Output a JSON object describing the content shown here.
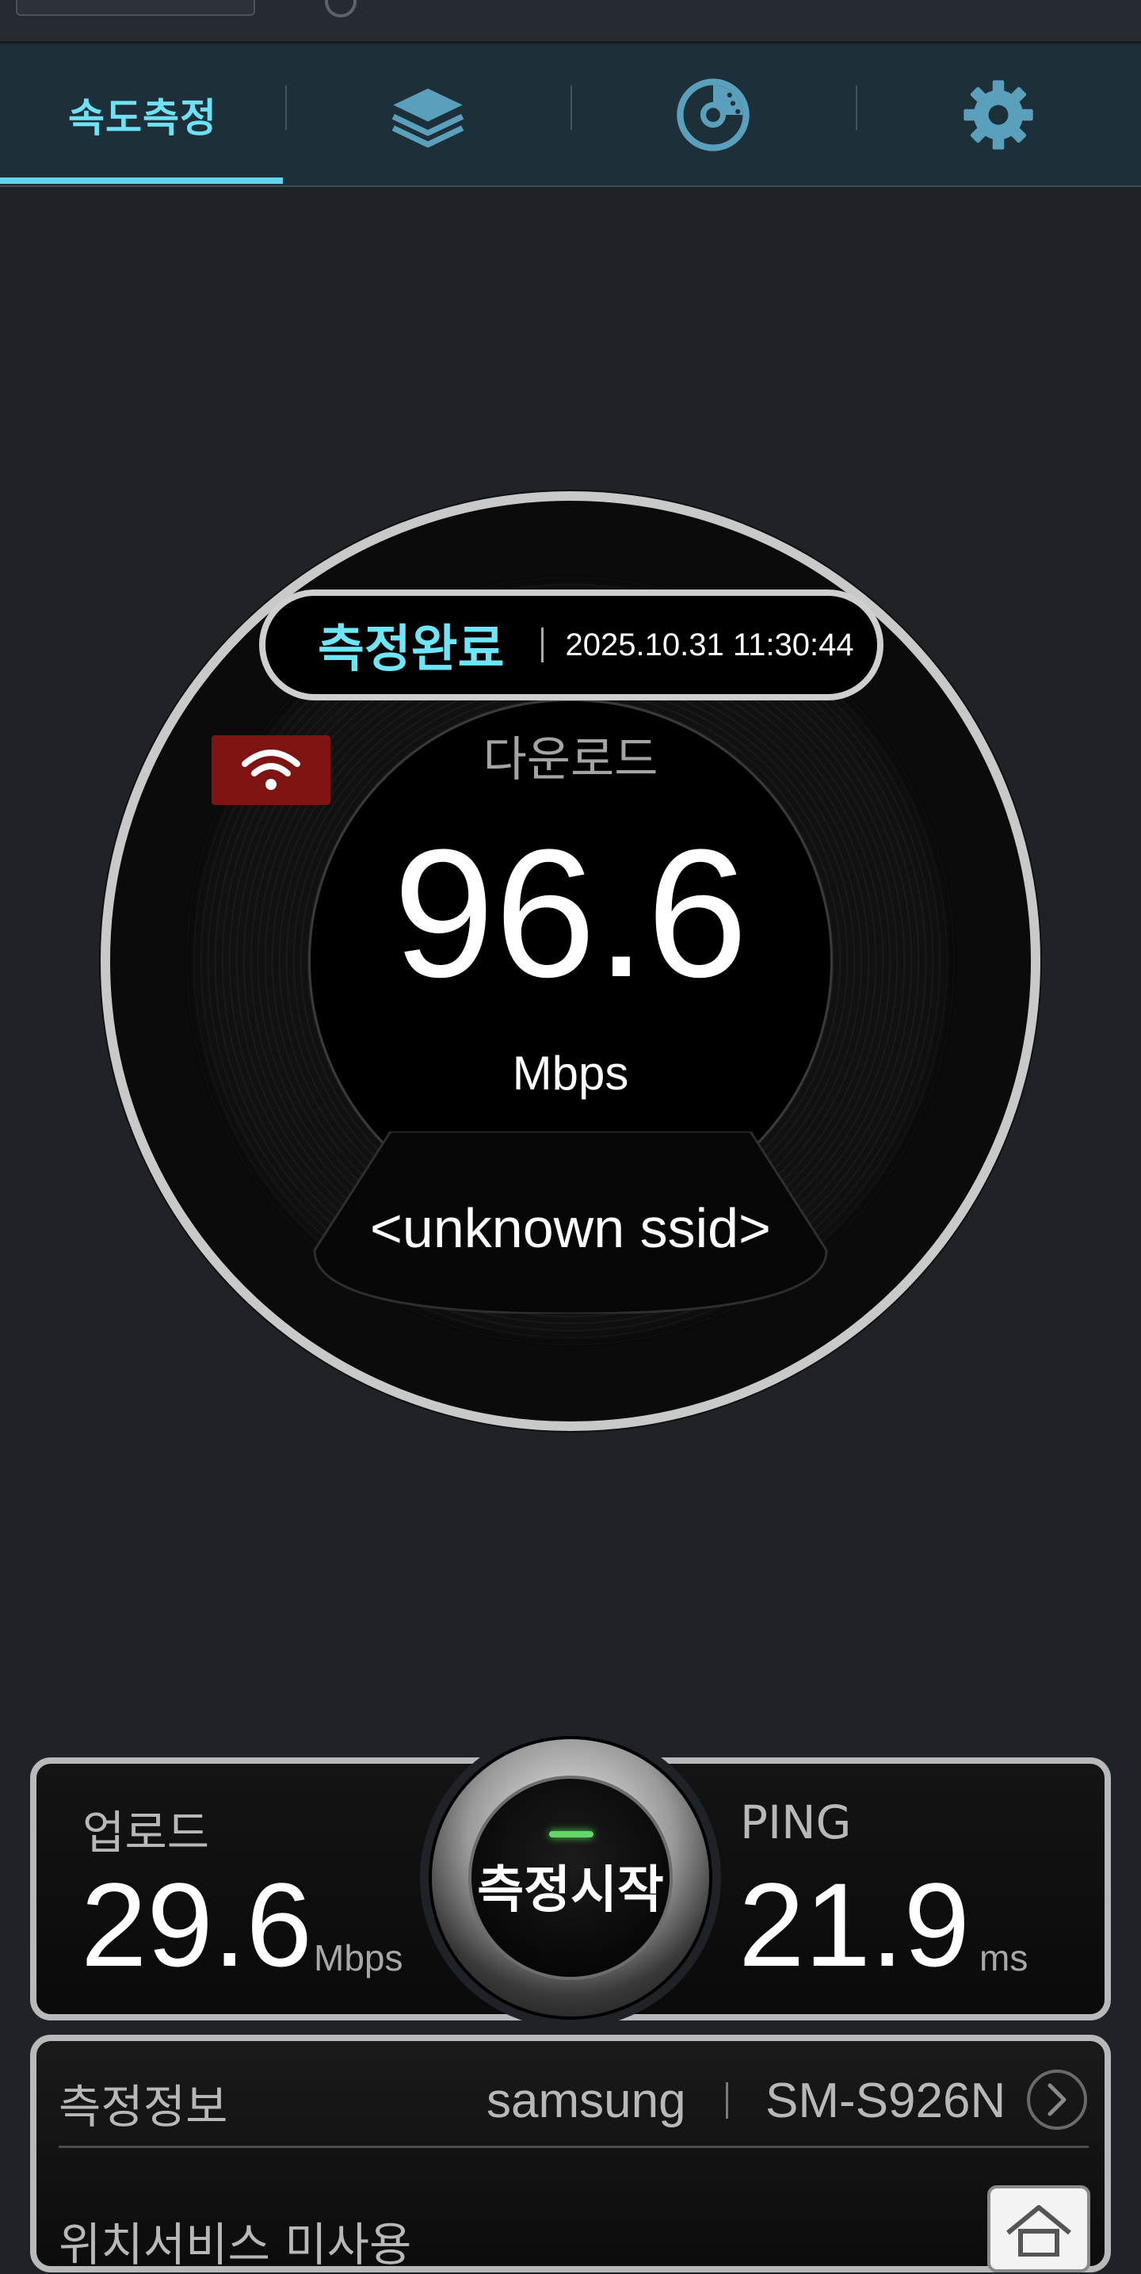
{
  "tabs": [
    {
      "label": "속도측정",
      "icon": "speedometer-tab",
      "active": true
    },
    {
      "icon": "layers-icon",
      "active": false
    },
    {
      "icon": "disc-chart-icon",
      "active": false
    },
    {
      "icon": "gear-icon",
      "active": false
    }
  ],
  "gauge": {
    "status": "측정완료",
    "datetime": "2025.10.31 11:30:44",
    "connection_icon": "wifi-icon",
    "download_label": "다운로드",
    "download_value": "96.6",
    "download_unit": "Mbps",
    "ssid": "<unknown ssid>"
  },
  "stats": {
    "upload_label": "업로드",
    "upload_value": "29.6",
    "upload_unit": "Mbps",
    "ping_label": "PING",
    "ping_value": "21.9",
    "ping_unit": "ms",
    "start_label": "측정시작"
  },
  "info": {
    "title": "측정정보",
    "maker": "samsung",
    "model": "SM-S926N",
    "location_label": "위치서비스 미사용"
  },
  "colors": {
    "accent": "#6fe1f5",
    "background": "#1f2328",
    "tabbar": "#1d3039",
    "wifi_badge": "#7e1512",
    "led": "#66d66a"
  }
}
